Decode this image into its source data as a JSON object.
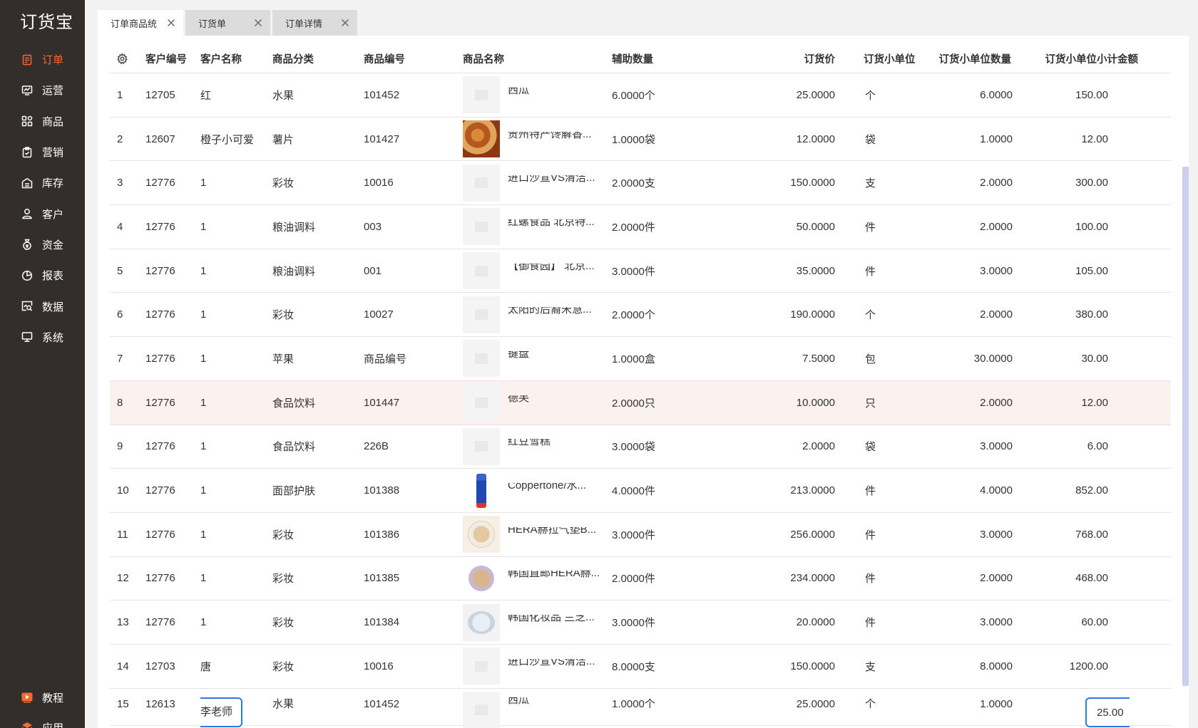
{
  "app": {
    "logo": "订货宝"
  },
  "sidebar": {
    "items": [
      {
        "label": "订单",
        "icon": "order-icon",
        "active": true
      },
      {
        "label": "运营",
        "icon": "operations-icon",
        "active": false
      },
      {
        "label": "商品",
        "icon": "goods-icon",
        "active": false
      },
      {
        "label": "营销",
        "icon": "marketing-icon",
        "active": false
      },
      {
        "label": "库存",
        "icon": "warehouse-icon",
        "active": false
      },
      {
        "label": "客户",
        "icon": "customer-icon",
        "active": false
      },
      {
        "label": "资金",
        "icon": "money-bag-icon",
        "active": false
      },
      {
        "label": "报表",
        "icon": "pie-chart-icon",
        "active": false
      },
      {
        "label": "数据",
        "icon": "data-search-icon",
        "active": false
      },
      {
        "label": "系统",
        "icon": "monitor-icon",
        "active": false
      }
    ],
    "bottom": [
      {
        "label": "教程",
        "icon": "video-play-icon"
      },
      {
        "label": "应用",
        "icon": "apps-icon"
      }
    ]
  },
  "tabs": [
    {
      "label": "订单商品统",
      "active": true
    },
    {
      "label": "订货单",
      "active": false
    },
    {
      "label": "订单详情",
      "active": false
    }
  ],
  "table": {
    "headers": {
      "settings_icon": "gear-icon",
      "customer_no": "客户编号",
      "customer_name": "客户名称",
      "category": "商品分类",
      "product_code": "商品编号",
      "product_name": "商品名称",
      "aux_qty": "辅助数量",
      "price": "订货价",
      "unit": "订货小单位",
      "unit_qty": "订货小单位数量",
      "subtotal": "订货小单位小计金额"
    },
    "rows": [
      {
        "idx": "1",
        "customer_no": "12705",
        "customer_name": "红",
        "category": "水果",
        "product_code": "101452",
        "image": "placeholder",
        "product_name": "西瓜",
        "aux_qty": "6.0000个",
        "price": "25.0000",
        "unit": "个",
        "unit_qty": "6.0000",
        "subtotal": "150.00"
      },
      {
        "idx": "2",
        "customer_no": "12607",
        "customer_name": "橙子小可爱",
        "category": "薯片",
        "product_code": "101427",
        "image": "food-photo",
        "product_name": "贵州特产馋解香...",
        "aux_qty": "1.0000袋",
        "price": "12.0000",
        "unit": "袋",
        "unit_qty": "1.0000",
        "subtotal": "12.00"
      },
      {
        "idx": "3",
        "customer_no": "12776",
        "customer_name": "1",
        "category": "彩妆",
        "product_code": "10016",
        "image": "placeholder",
        "product_name": "进口沙宣VS清洁...",
        "aux_qty": "2.0000支",
        "price": "150.0000",
        "unit": "支",
        "unit_qty": "2.0000",
        "subtotal": "300.00"
      },
      {
        "idx": "4",
        "customer_no": "12776",
        "customer_name": "1",
        "category": "粮油调料",
        "product_code": "003",
        "image": "placeholder",
        "product_name": "红螺食品 北京特...",
        "aux_qty": "2.0000件",
        "price": "50.0000",
        "unit": "件",
        "unit_qty": "2.0000",
        "subtotal": "100.00"
      },
      {
        "idx": "5",
        "customer_no": "12776",
        "customer_name": "1",
        "category": "粮油调料",
        "product_code": "001",
        "image": "placeholder",
        "product_name": "【御食园】 北京...",
        "aux_qty": "3.0000件",
        "price": "35.0000",
        "unit": "件",
        "unit_qty": "3.0000",
        "subtotal": "105.00"
      },
      {
        "idx": "6",
        "customer_no": "12776",
        "customer_name": "1",
        "category": "彩妆",
        "product_code": "10027",
        "image": "placeholder",
        "product_name": "太阳的后裔宋慧...",
        "aux_qty": "2.0000个",
        "price": "190.0000",
        "unit": "个",
        "unit_qty": "2.0000",
        "subtotal": "380.00"
      },
      {
        "idx": "7",
        "customer_no": "12776",
        "customer_name": "1",
        "category": "苹果",
        "product_code": "商品编号",
        "image": "placeholder",
        "product_name": "键盘",
        "aux_qty": "1.0000盒",
        "price": "7.5000",
        "unit": "包",
        "unit_qty": "30.0000",
        "subtotal": "30.00"
      },
      {
        "idx": "8",
        "customer_no": "12776",
        "customer_name": "1",
        "category": "食品饮料",
        "product_code": "101447",
        "image": "placeholder",
        "product_name": "德芙",
        "aux_qty": "2.0000只",
        "price": "10.0000",
        "unit": "只",
        "unit_qty": "2.0000",
        "subtotal": "12.00",
        "highlight": true
      },
      {
        "idx": "9",
        "customer_no": "12776",
        "customer_name": "1",
        "category": "食品饮料",
        "product_code": "226B",
        "image": "placeholder",
        "product_name": "红豆雪糕",
        "aux_qty": "3.0000袋",
        "price": "2.0000",
        "unit": "袋",
        "unit_qty": "3.0000",
        "subtotal": "6.00"
      },
      {
        "idx": "10",
        "customer_no": "12776",
        "customer_name": "1",
        "category": "面部护肤",
        "product_code": "101388",
        "image": "tube-photo",
        "product_name": "Coppertone/水...",
        "aux_qty": "4.0000件",
        "price": "213.0000",
        "unit": "件",
        "unit_qty": "4.0000",
        "subtotal": "852.00"
      },
      {
        "idx": "11",
        "customer_no": "12776",
        "customer_name": "1",
        "category": "彩妆",
        "product_code": "101386",
        "image": "cushion-photo",
        "product_name": "HERA赫拉气垫B...",
        "aux_qty": "3.0000件",
        "price": "256.0000",
        "unit": "件",
        "unit_qty": "3.0000",
        "subtotal": "768.00"
      },
      {
        "idx": "12",
        "customer_no": "12776",
        "customer_name": "1",
        "category": "彩妆",
        "product_code": "101385",
        "image": "cushion2-photo",
        "product_name": "韩国直邮HERA赫...",
        "aux_qty": "2.0000件",
        "price": "234.0000",
        "unit": "件",
        "unit_qty": "2.0000",
        "subtotal": "468.00"
      },
      {
        "idx": "13",
        "customer_no": "12776",
        "customer_name": "1",
        "category": "彩妆",
        "product_code": "101384",
        "image": "cushion3-photo",
        "product_name": "韩国化妆品 兰芝...",
        "aux_qty": "3.0000件",
        "price": "20.0000",
        "unit": "件",
        "unit_qty": "3.0000",
        "subtotal": "60.00"
      },
      {
        "idx": "14",
        "customer_no": "12703",
        "customer_name": "唐",
        "category": "彩妆",
        "product_code": "10016",
        "image": "placeholder",
        "product_name": "进口沙宣VS清洁...",
        "aux_qty": "8.0000支",
        "price": "150.0000",
        "unit": "支",
        "unit_qty": "8.0000",
        "subtotal": "1200.00"
      },
      {
        "idx": "15",
        "customer_no": "12613",
        "customer_name": "李老师",
        "category": "水果",
        "product_code": "101452",
        "image": "placeholder",
        "product_name": "西瓜",
        "aux_qty": "1.0000个",
        "price": "25.0000",
        "unit": "个",
        "unit_qty": "1.0000",
        "subtotal": "25.00"
      }
    ]
  },
  "colors": {
    "sidebar_bg": "#332e2c",
    "accent": "#f56a2f",
    "highlight_row": "#fbf1ee",
    "focus_border": "#2a7be4"
  }
}
